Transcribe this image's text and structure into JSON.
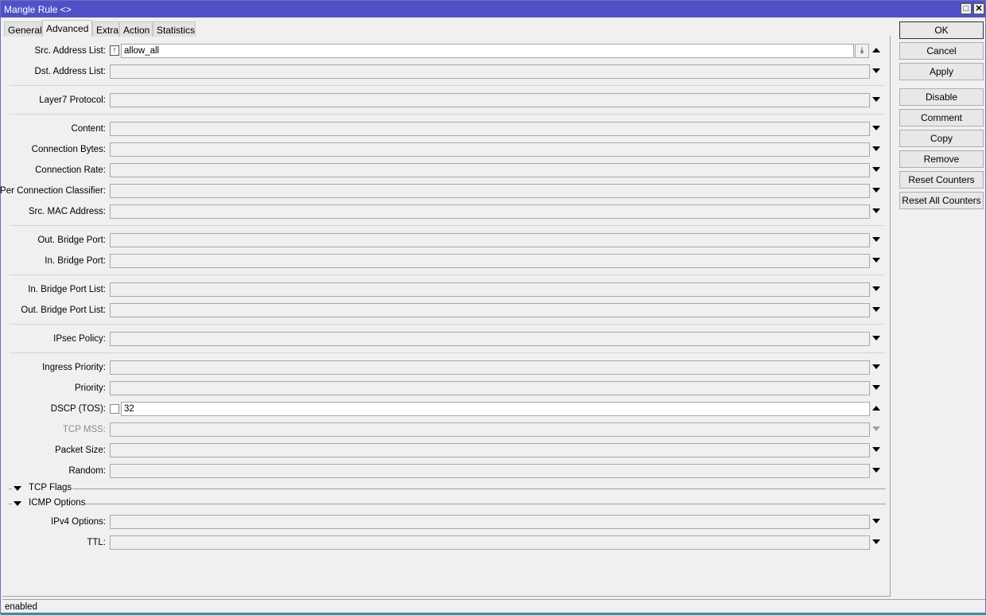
{
  "window": {
    "title": "Mangle Rule <>",
    "restore_icon": "□",
    "close_icon": "✕"
  },
  "tabs": [
    {
      "label": "General",
      "active": false
    },
    {
      "label": "Advanced",
      "active": true
    },
    {
      "label": "Extra",
      "active": false
    },
    {
      "label": "Action",
      "active": false
    },
    {
      "label": "Statistics",
      "active": false
    }
  ],
  "fields": {
    "src_address_list": {
      "label": "Src. Address List:",
      "value": "allow_all",
      "negate_icon": "!"
    },
    "dst_address_list": {
      "label": "Dst. Address List:",
      "value": ""
    },
    "layer7_protocol": {
      "label": "Layer7 Protocol:",
      "value": ""
    },
    "content": {
      "label": "Content:",
      "value": ""
    },
    "connection_bytes": {
      "label": "Connection Bytes:",
      "value": ""
    },
    "connection_rate": {
      "label": "Connection Rate:",
      "value": ""
    },
    "per_connection_classifier": {
      "label": "Per Connection Classifier:",
      "value": ""
    },
    "src_mac_address": {
      "label": "Src. MAC Address:",
      "value": ""
    },
    "out_bridge_port": {
      "label": "Out. Bridge Port:",
      "value": ""
    },
    "in_bridge_port": {
      "label": "In. Bridge Port:",
      "value": ""
    },
    "in_bridge_port_list": {
      "label": "In. Bridge Port List:",
      "value": ""
    },
    "out_bridge_port_list": {
      "label": "Out. Bridge Port List:",
      "value": ""
    },
    "ipsec_policy": {
      "label": "IPsec Policy:",
      "value": ""
    },
    "ingress_priority": {
      "label": "Ingress Priority:",
      "value": ""
    },
    "priority": {
      "label": "Priority:",
      "value": ""
    },
    "dscp_tos": {
      "label": "DSCP (TOS):",
      "value": "32",
      "negate": false
    },
    "tcp_mss": {
      "label": "TCP MSS:",
      "value": "",
      "disabled": true
    },
    "packet_size": {
      "label": "Packet Size:",
      "value": ""
    },
    "random": {
      "label": "Random:",
      "value": ""
    },
    "ipv4_options": {
      "label": "IPv4 Options:",
      "value": ""
    },
    "ttl": {
      "label": "TTL:",
      "value": ""
    }
  },
  "groups": {
    "tcp_flags": "TCP Flags",
    "icmp_options": "ICMP Options"
  },
  "buttons": {
    "ok": "OK",
    "cancel": "Cancel",
    "apply": "Apply",
    "disable": "Disable",
    "comment": "Comment",
    "copy": "Copy",
    "remove": "Remove",
    "reset_counters": "Reset Counters",
    "reset_all_counters": "Reset All Counters"
  },
  "status": {
    "text": "enabled"
  }
}
